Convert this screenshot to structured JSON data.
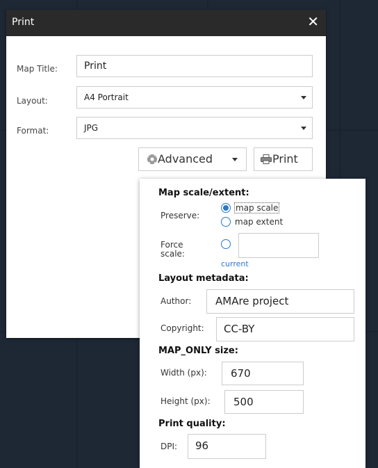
{
  "panel": {
    "title": "Print",
    "close_glyph": "✕"
  },
  "form": {
    "map_title_label": "Map Title:",
    "map_title_value": "Print",
    "layout_label": "Layout:",
    "layout_value": "A4 Portrait",
    "format_label": "Format:",
    "format_value": "JPG"
  },
  "toolbar": {
    "advanced_label": "Advanced",
    "print_label": "Print"
  },
  "advanced": {
    "map_scale_extent_head": "Map scale/extent:",
    "preserve_label": "Preserve:",
    "option_map_scale": "map scale",
    "option_map_extent": "map extent",
    "preserve_selected": "map scale",
    "force_scale_label": "Force scale:",
    "force_scale_value": "",
    "current_link": "current",
    "layout_metadata_head": "Layout metadata:",
    "author_label": "Author:",
    "author_value": "AMAre project",
    "copyright_label": "Copyright:",
    "copyright_value": "CC-BY",
    "map_only_head": "MAP_ONLY size:",
    "width_label": "Width (px):",
    "width_value": "670",
    "height_label": "Height (px):",
    "height_value": "500",
    "print_quality_head": "Print quality:",
    "dpi_label": "DPI:",
    "dpi_value": "96"
  },
  "colors": {
    "titlebar": "#2a2a2a",
    "accent": "#2a78c7",
    "map_background": "#1e2835"
  },
  "icons": {
    "close": "close-icon",
    "advanced": "gear-icon",
    "print": "printer-icon",
    "dropdown": "chevron-down-icon"
  }
}
